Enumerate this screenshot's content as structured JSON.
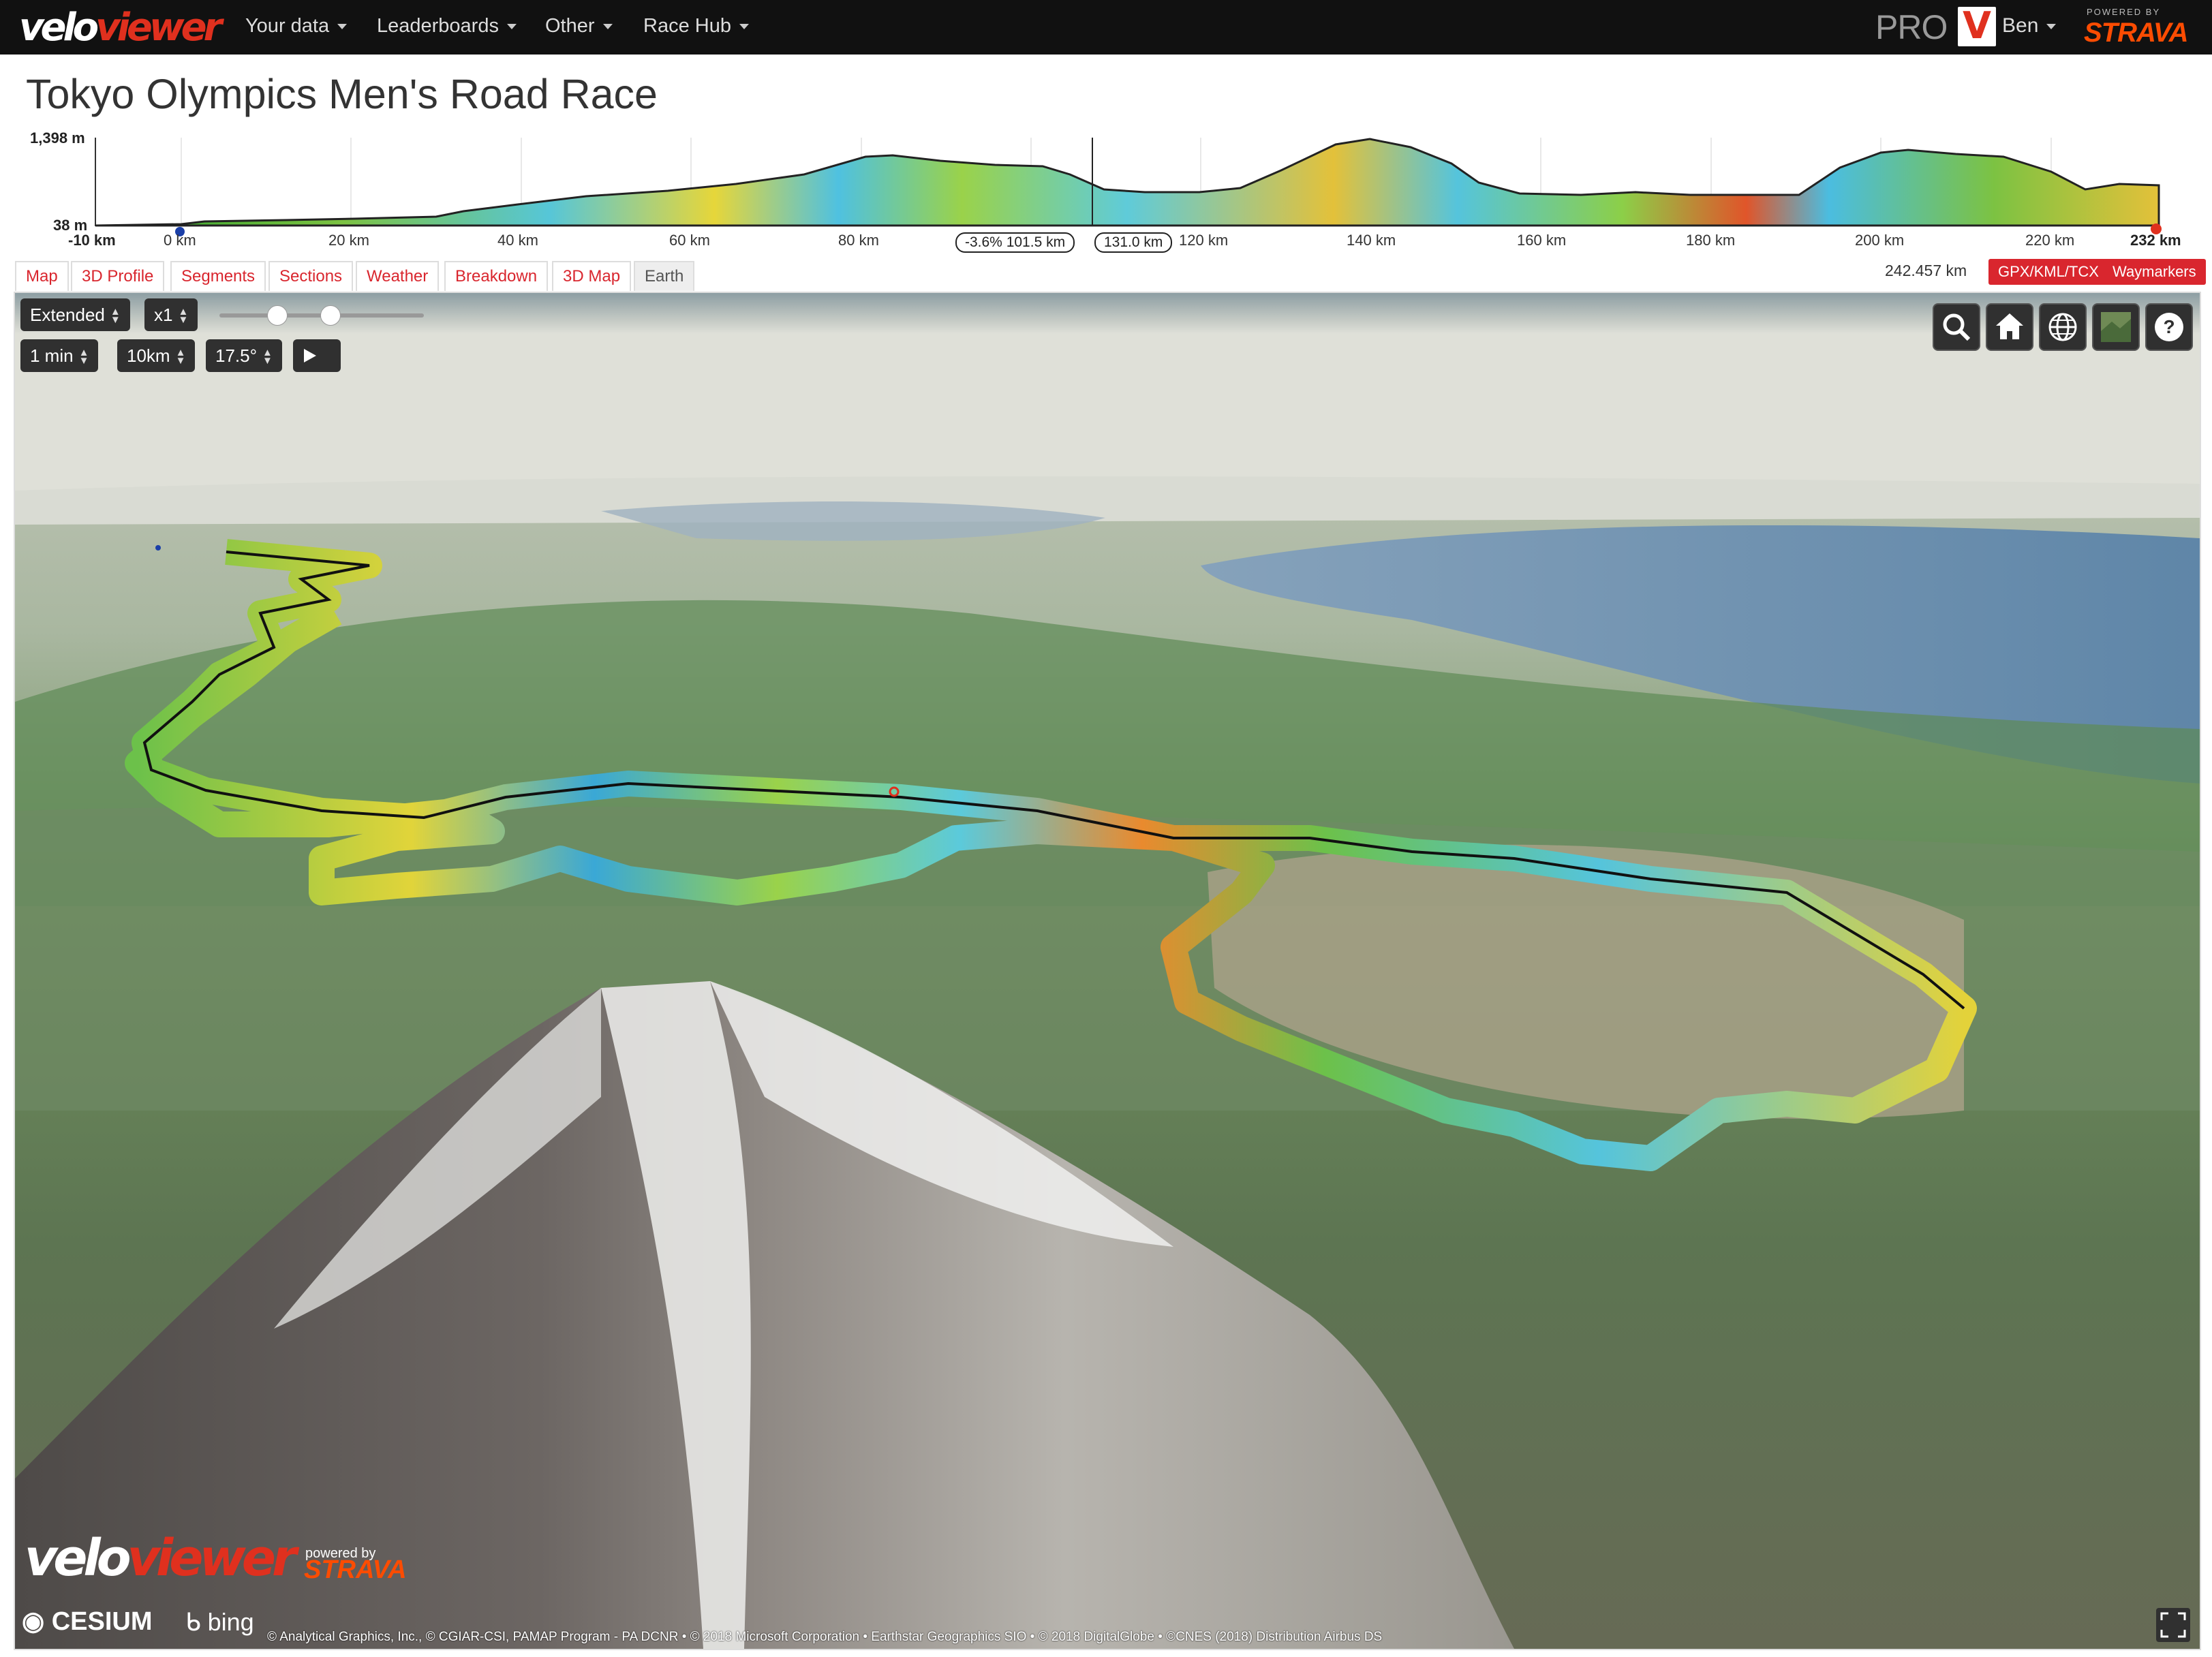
{
  "navbar": {
    "logo_part1": "velo",
    "logo_part2": "viewer",
    "items": [
      {
        "label": "Your data"
      },
      {
        "label": "Leaderboards"
      },
      {
        "label": "Other"
      },
      {
        "label": "Race Hub"
      }
    ],
    "pro_label": "PRO",
    "badge_letter": "V",
    "user_name": "Ben",
    "powered_by": "POWERED BY",
    "strava": "STRAVA"
  },
  "page": {
    "title": "Tokyo Olympics Men's Road Race"
  },
  "profile": {
    "y_max": "1,398 m",
    "y_min": "38 m",
    "x_start": "-10 km",
    "x_end": "232 km",
    "ticks": [
      "0 km",
      "20 km",
      "40 km",
      "60 km",
      "80 km",
      "120 km",
      "140 km",
      "160 km",
      "180 km",
      "200 km",
      "220 km"
    ],
    "marker_left": "-3.6% 101.5 km",
    "marker_right": "131.0 km"
  },
  "tabs": [
    {
      "label": "Map"
    },
    {
      "label": "3D Profile"
    },
    {
      "label": "Segments"
    },
    {
      "label": "Sections"
    },
    {
      "label": "Weather"
    },
    {
      "label": "Breakdown"
    },
    {
      "label": "3D Map"
    },
    {
      "label": "Earth"
    }
  ],
  "distance": "242.457 km",
  "buttons": {
    "export": "GPX/KML/TCX",
    "waymarkers": "Waymarkers"
  },
  "map_controls": {
    "mode": "Extended",
    "speed": "x1",
    "time_step": "1 min",
    "distance_step": "10km",
    "angle": "17.5°"
  },
  "map_footer": {
    "logo_part1": "velo",
    "logo_part2": "viewer",
    "powered_by": "powered by",
    "strava": "STRAVA",
    "cesium": "CESIUM",
    "bing": "bing",
    "attribution": "© Analytical Graphics, Inc., © CGIAR-CSI, PAMAP Program - PA DCNR • © 2018 Microsoft Corporation • Earthstar Geographics SIO • © 2018 DigitalGlobe • ©CNES (2018) Distribution Airbus DS"
  },
  "colors": {
    "accent_red": "#d9262e",
    "strava_orange": "#fc4c02",
    "navbar": "#111111"
  }
}
